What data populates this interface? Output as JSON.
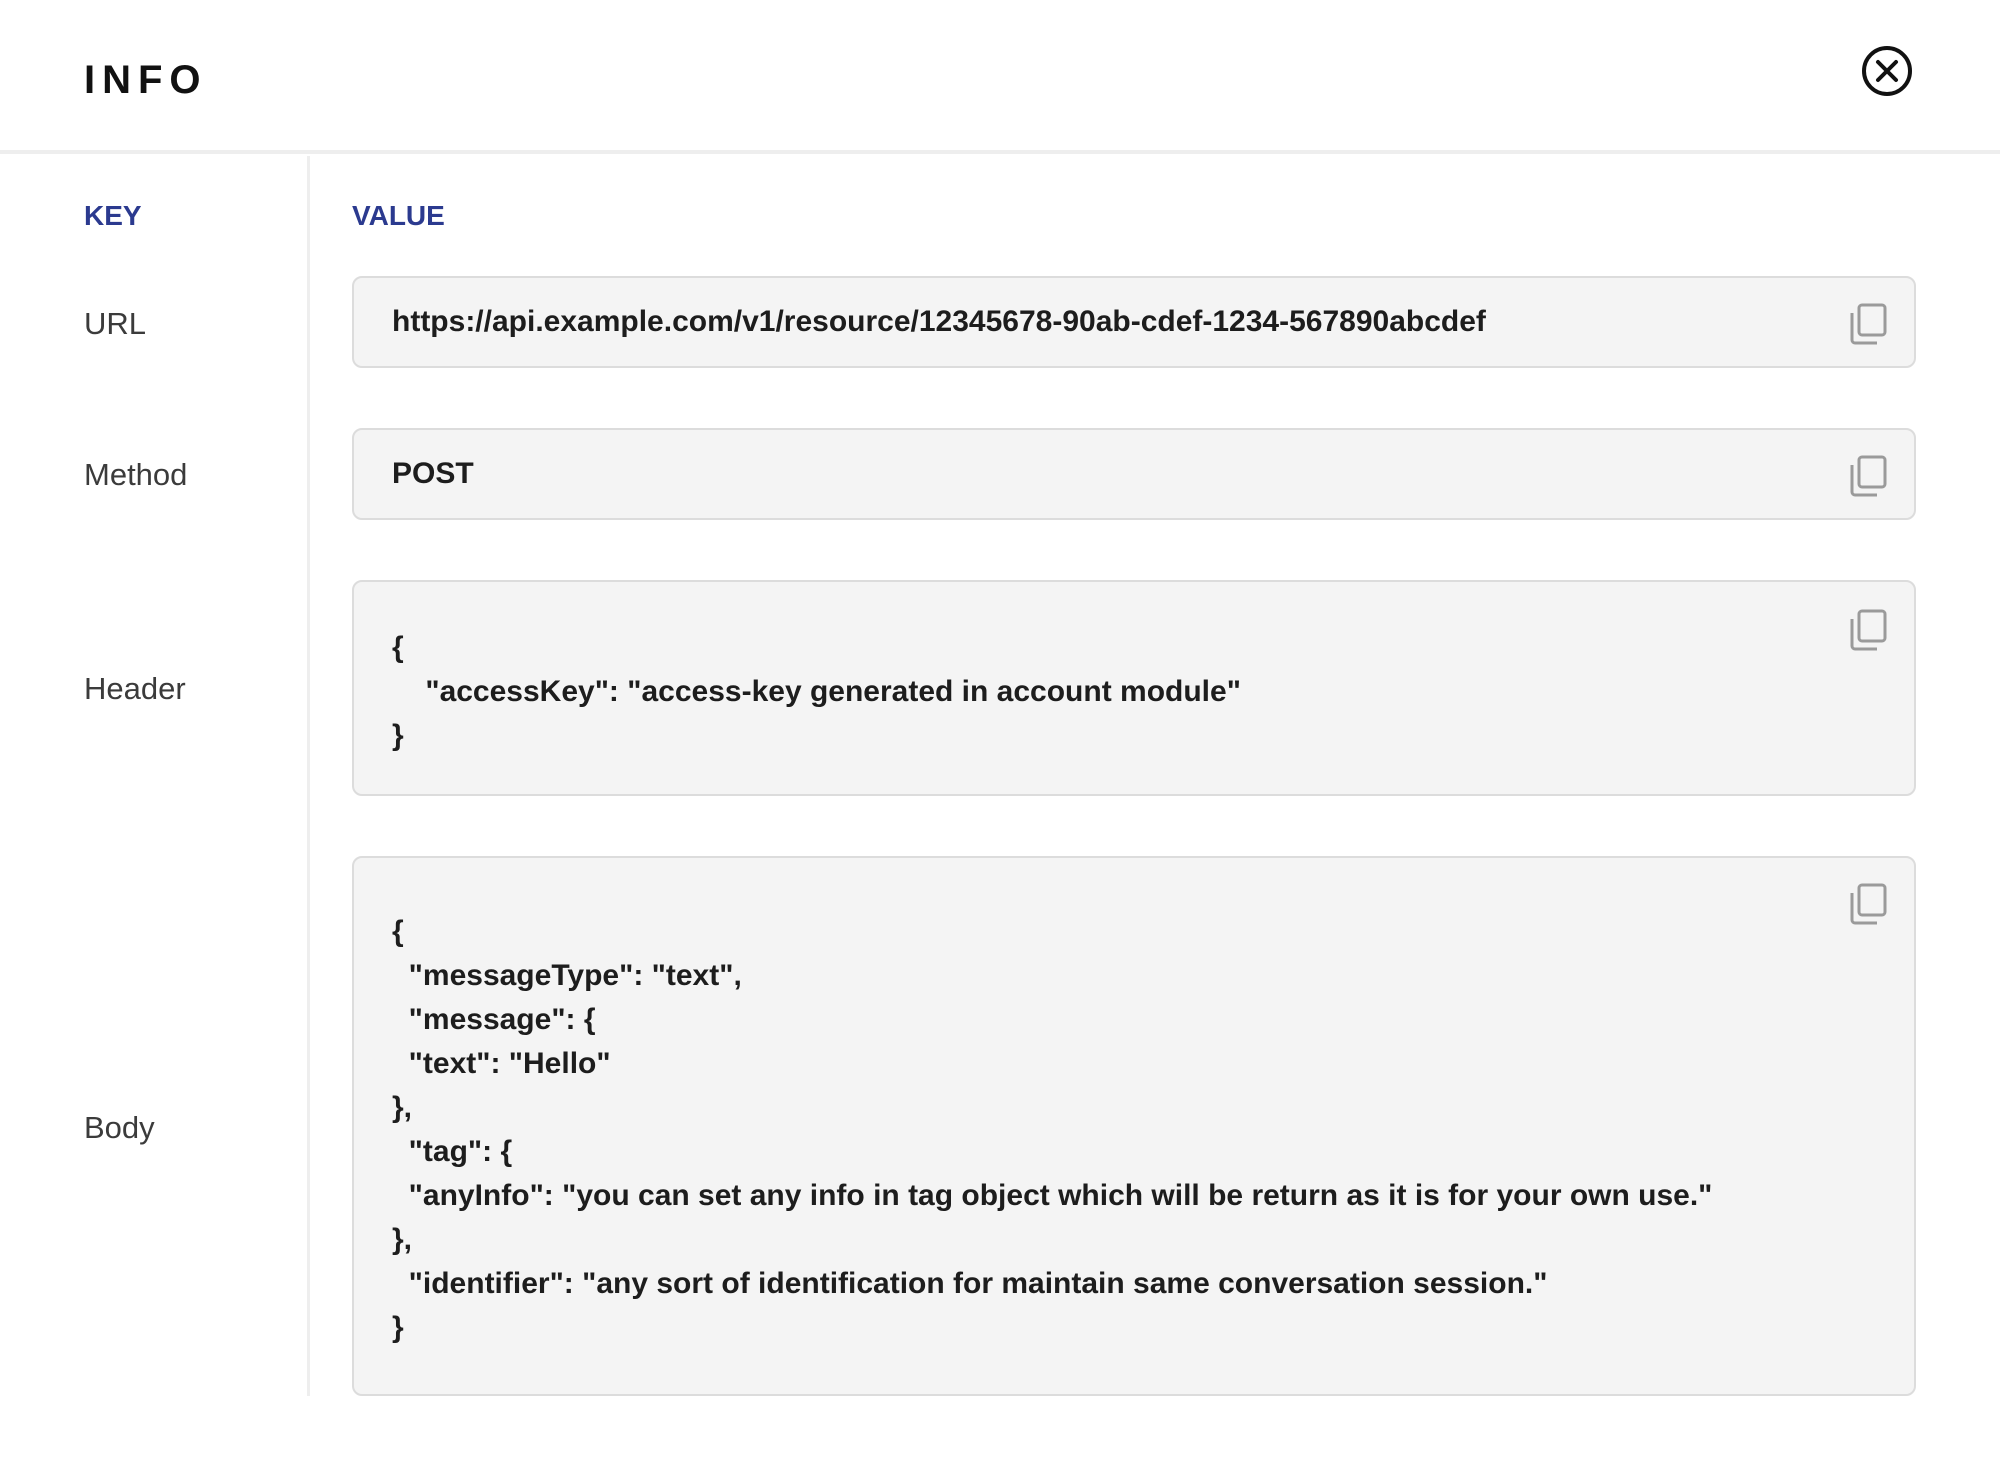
{
  "dialog": {
    "title": "INFO"
  },
  "columns": {
    "key": "KEY",
    "value": "VALUE"
  },
  "rows": [
    {
      "key": "URL",
      "value": "https://api.example.com/v1/resource/12345678-90ab-cdef-1234-567890abcdef"
    },
    {
      "key": "Method",
      "value": "POST"
    },
    {
      "key": "Header",
      "value": "{\n    \"accessKey\": \"access-key generated in account module\"\n}"
    },
    {
      "key": "Body",
      "value": "{\n  \"messageType\": \"text\",\n  \"message\": {\n  \"text\": \"Hello\"\n},\n  \"tag\": {\n  \"anyInfo\": \"you can set any info in tag object which will be return as it is for your own use.\"\n},\n  \"identifier\": \"any sort of identification for maintain same conversation session.\"\n}"
    }
  ],
  "icons": {
    "close": "close-circle-icon",
    "copy": "copy-icon"
  },
  "colors": {
    "accent": "#2b3a8f",
    "box_bg": "#f4f4f4",
    "box_border": "#dcdcdc",
    "icon": "#9a9a9a"
  }
}
